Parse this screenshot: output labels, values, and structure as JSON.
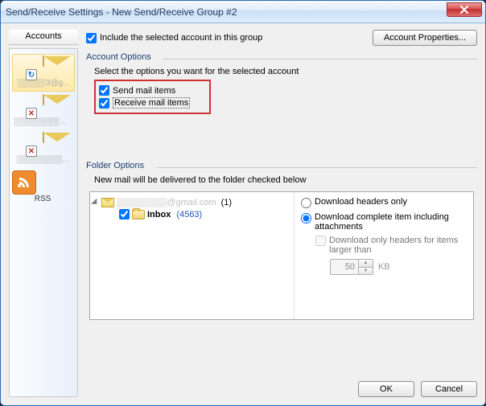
{
  "window": {
    "title": "Send/Receive Settings - New Send/Receive Group #2"
  },
  "sidebar": {
    "header": "Accounts",
    "items": [
      {
        "label": "▒▒▒▒▒3@g...",
        "kind": "sync"
      },
      {
        "label": "▒▒▒▒▒▒▒▒@...",
        "kind": "err"
      },
      {
        "label": "▒▒▒▒▒▒▒▒...",
        "kind": "err"
      },
      {
        "label": "RSS",
        "kind": "rss"
      }
    ]
  },
  "top": {
    "include_label": "Include the selected account in this group",
    "include_checked": true,
    "account_props_btn": "Account Properties..."
  },
  "account_options": {
    "group_title": "Account Options",
    "subtitle": "Select the options you want for the selected account",
    "send_label": "Send mail items",
    "send_checked": true,
    "receive_label": "Receive mail items",
    "receive_checked": true
  },
  "folder_options": {
    "group_title": "Folder Options",
    "subtitle": "New mail will be delivered to the folder checked below",
    "root_label": "▒▒▒▒▒▒▒▒@gmail.com",
    "root_count": "(1)",
    "inbox_label": "Inbox",
    "inbox_count": "(4563)",
    "inbox_checked": true,
    "dl_headers_label": "Download headers only",
    "dl_complete_label": "Download complete item including attachments",
    "dl_selected": "complete",
    "dl_only_headers_larger_label": "Download only headers for items larger than",
    "dl_only_headers_larger_checked": false,
    "size_value": "50",
    "size_unit": "KB"
  },
  "buttons": {
    "ok": "OK",
    "cancel": "Cancel"
  }
}
